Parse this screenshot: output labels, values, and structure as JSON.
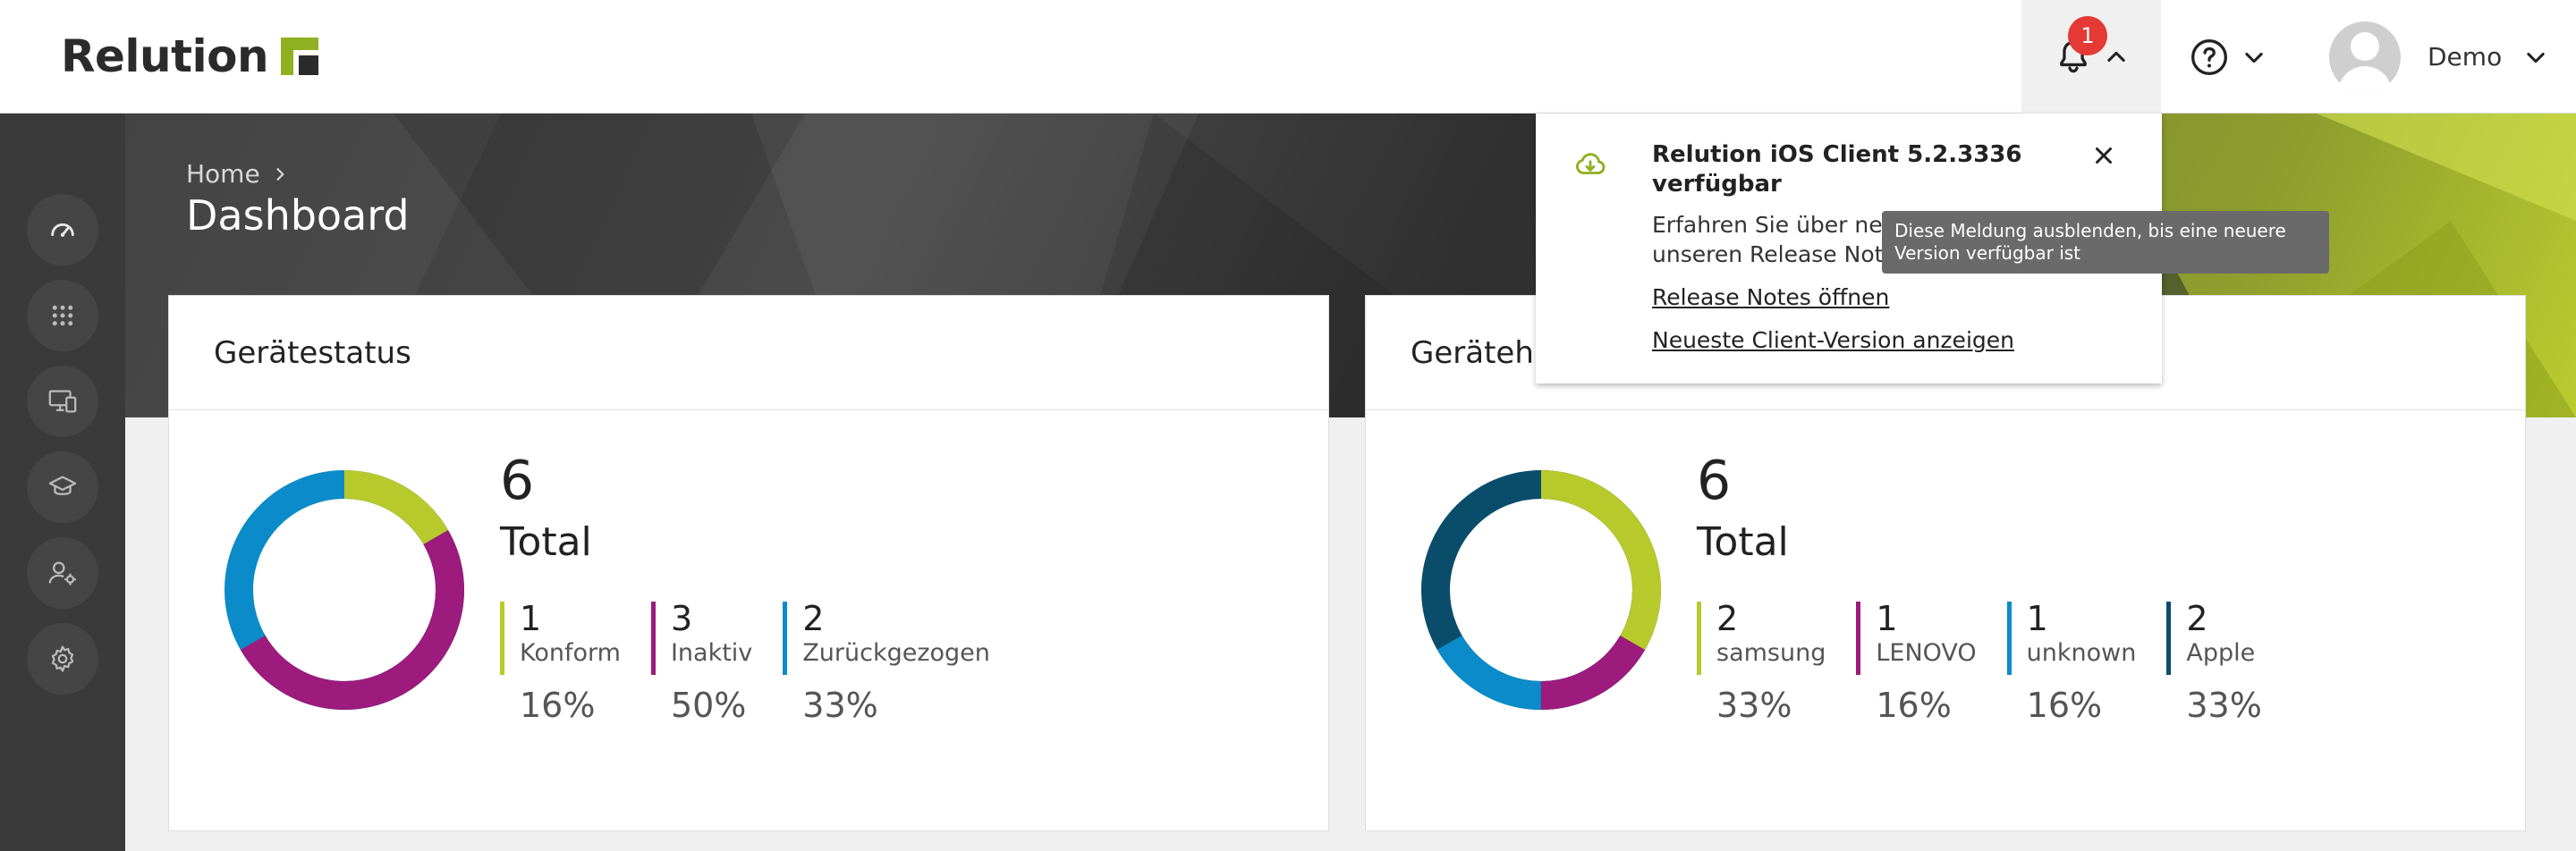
{
  "header": {
    "logo_text": "Relution",
    "notification_count": "1",
    "user_name": "Demo"
  },
  "breadcrumb": {
    "home": "Home"
  },
  "page_title": "Dashboard",
  "colors": {
    "lime": "#b8c92c",
    "purple": "#9c1b7d",
    "blue": "#0b8bc9",
    "dark_teal": "#0a4d6b"
  },
  "sidebar": {
    "items": [
      {
        "icon": "dashboard-icon"
      },
      {
        "icon": "apps-grid-icon"
      },
      {
        "icon": "devices-icon"
      },
      {
        "icon": "education-icon"
      },
      {
        "icon": "user-settings-icon"
      },
      {
        "icon": "gear-icon"
      }
    ]
  },
  "cards": [
    {
      "title": "Gerätestatus",
      "total": "6",
      "total_label": "Total",
      "legend": [
        {
          "count": "1",
          "label": "Konform",
          "percent": "16%",
          "color": "#b8c92c"
        },
        {
          "count": "3",
          "label": "Inaktiv",
          "percent": "50%",
          "color": "#9c1b7d"
        },
        {
          "count": "2",
          "label": "Zurückgezogen",
          "percent": "33%",
          "color": "#0b8bc9"
        }
      ]
    },
    {
      "title": "Geräteh",
      "total": "6",
      "total_label": "Total",
      "legend": [
        {
          "count": "2",
          "label": "samsung",
          "percent": "33%",
          "color": "#b8c92c"
        },
        {
          "count": "1",
          "label": "LENOVO",
          "percent": "16%",
          "color": "#9c1b7d"
        },
        {
          "count": "1",
          "label": "unknown",
          "percent": "16%",
          "color": "#0b8bc9"
        },
        {
          "count": "2",
          "label": "Apple",
          "percent": "33%",
          "color": "#0a4d6b"
        }
      ]
    }
  ],
  "notification": {
    "title": "Relution iOS Client 5.2.3336 verfügbar",
    "body_line1": "Erfahren Sie über neue",
    "body_line2": "unseren Release Notes",
    "link_release_notes": "Release Notes öffnen",
    "link_latest_client": "Neueste Client-Version anzeigen",
    "tooltip": "Diese Meldung ausblenden, bis eine neuere Version verfügbar ist"
  }
}
